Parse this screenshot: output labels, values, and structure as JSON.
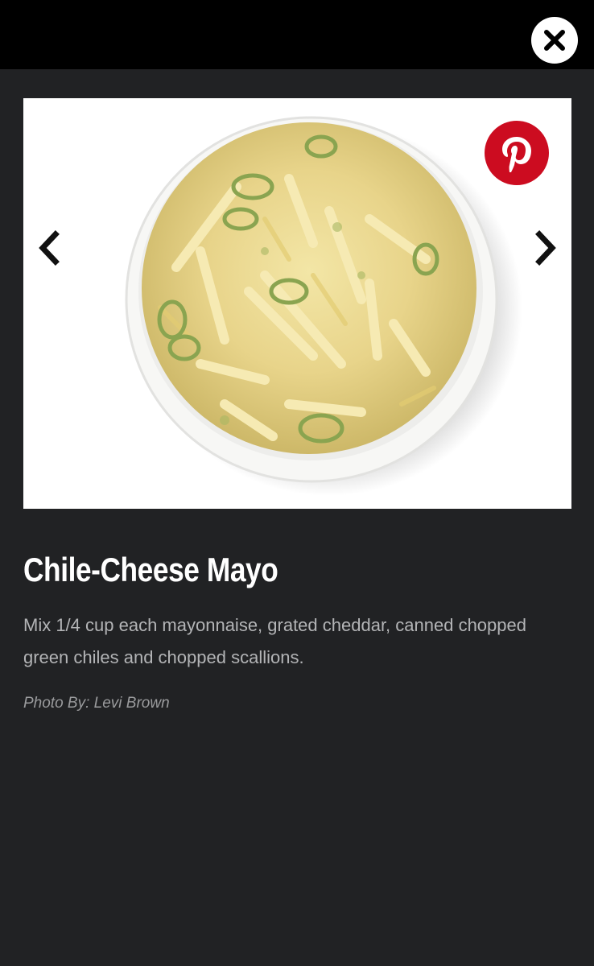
{
  "header": {
    "close_icon": "close-icon"
  },
  "gallery": {
    "image_alt": "Chile-Cheese Mayo in white bowl",
    "pinterest_icon": "pinterest-icon",
    "pinterest_color": "#cc0c20",
    "prev_icon": "chevron-left-icon",
    "next_icon": "chevron-right-icon"
  },
  "caption": {
    "title": "Chile-Cheese Mayo",
    "description": "Mix 1/4 cup each mayonnaise, grated cheddar, canned chopped green chiles and chopped scallions.",
    "photo_credit": "Photo By: Levi Brown"
  },
  "colors": {
    "page_background": "#212224",
    "header_background": "#000000",
    "title_text": "#ffffff",
    "body_text": "#b3b4b6"
  }
}
